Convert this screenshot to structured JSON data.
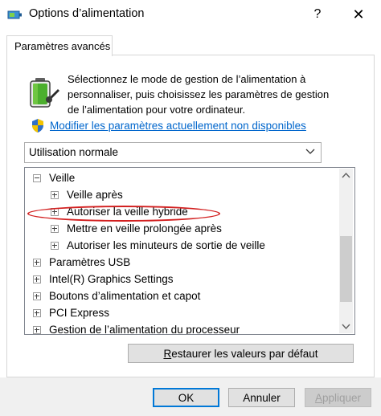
{
  "window": {
    "title": "Options d’alimentation",
    "help_label": "?",
    "close_label": "✕"
  },
  "tab": {
    "label": "Paramètres avancés"
  },
  "description": "Sélectionnez le mode de gestion de l’alimentation à personnaliser, puis choisissez les paramètres de gestion de l’alimentation pour votre ordinateur.",
  "link": {
    "label": "Modifier les paramètres actuellement non disponibles"
  },
  "plan_select": {
    "value": "Utilisation normale"
  },
  "tree": {
    "items": [
      {
        "label": "Veille",
        "expanded": true,
        "level": 0
      },
      {
        "label": "Veille après",
        "expanded": false,
        "level": 1
      },
      {
        "label": "Autoriser la veille hybride",
        "expanded": false,
        "level": 1,
        "highlighted": true
      },
      {
        "label": "Mettre en veille prolongée après",
        "expanded": false,
        "level": 1
      },
      {
        "label": "Autoriser les minuteurs de sortie de veille",
        "expanded": false,
        "level": 1
      },
      {
        "label": "Paramètres USB",
        "expanded": false,
        "level": 0
      },
      {
        "label": "Intel(R) Graphics Settings",
        "expanded": false,
        "level": 0
      },
      {
        "label": "Boutons d’alimentation et capot",
        "expanded": false,
        "level": 0
      },
      {
        "label": "PCI Express",
        "expanded": false,
        "level": 0
      },
      {
        "label": "Gestion de l’alimentation du processeur",
        "expanded": false,
        "level": 0
      }
    ]
  },
  "buttons": {
    "restore": {
      "accel": "R",
      "rest": "estaurer les valeurs par défaut"
    },
    "ok": "OK",
    "cancel": "Annuler",
    "apply": {
      "accel": "A",
      "rest": "ppliquer"
    }
  },
  "colors": {
    "link": "#0066cc",
    "highlight_ellipse": "#d21f1f",
    "ok_border": "#0078d7"
  }
}
